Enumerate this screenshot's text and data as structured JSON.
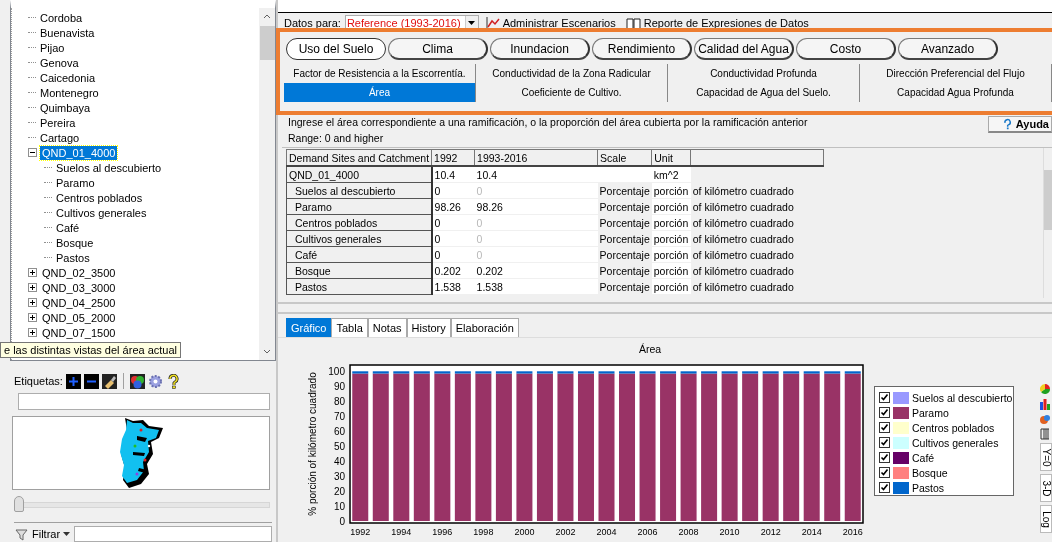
{
  "tree": [
    {
      "label": "Cordoba",
      "selected": false
    },
    {
      "label": "Buenavista",
      "selected": false
    },
    {
      "label": "Pijao",
      "selected": false
    },
    {
      "label": "Genova",
      "selected": false
    },
    {
      "label": "Caicedonia",
      "selected": false
    },
    {
      "label": "Montenegro",
      "selected": false
    },
    {
      "label": "Quimbaya",
      "selected": false
    },
    {
      "label": "Pereira",
      "selected": false
    },
    {
      "label": "Cartago",
      "selected": false
    },
    {
      "label": "QND_01_4000",
      "selected": true,
      "expanded": true,
      "children": [
        {
          "label": "Suelos al descubierto",
          "selected": false
        },
        {
          "label": "Paramo",
          "selected": false
        },
        {
          "label": "Centros poblados",
          "selected": false
        },
        {
          "label": "Cultivos generales",
          "selected": false
        },
        {
          "label": "Café",
          "selected": false
        },
        {
          "label": "Bosque",
          "selected": false
        },
        {
          "label": "Pastos",
          "selected": false
        }
      ]
    },
    {
      "label": "QND_02_3500",
      "selected": false,
      "expanded": false
    },
    {
      "label": "QND_03_3000",
      "selected": false,
      "expanded": false
    },
    {
      "label": "QND_04_2500",
      "selected": false,
      "expanded": false
    },
    {
      "label": "QND_05_2000",
      "selected": false,
      "expanded": false
    },
    {
      "label": "QND_07_1500",
      "selected": false,
      "expanded": false
    }
  ],
  "tooltip": "e las distintas vistas del área actual",
  "labels_toolbar": {
    "label": "Etiquetas:"
  },
  "zoom_slider": {
    "level": 0
  },
  "filter": {
    "label": "Filtrar"
  },
  "data_for": {
    "label": "Datos para:",
    "value": "Reference (1993-2016)"
  },
  "toolbar_buttons": [
    {
      "kind": "scenarios",
      "label": "Administrar Escenarios"
    },
    {
      "kind": "report",
      "label": "Reporte de Expresiones de Datos"
    }
  ],
  "categories": [
    {
      "label": "Uso del Suelo",
      "selected": true
    },
    {
      "label": "Clima",
      "selected": false
    },
    {
      "label": "Inundacion",
      "selected": false
    },
    {
      "label": "Rendimiento",
      "selected": false
    },
    {
      "label": "Calidad del Agua",
      "selected": false
    },
    {
      "label": "Costo",
      "selected": false
    },
    {
      "label": "Avanzado",
      "selected": false
    }
  ],
  "variable_tab_rows": [
    {
      "tabs": [
        {
          "label": "Factor de Resistencia a la Escorrentía.",
          "selected": false
        },
        {
          "label": "Conductividad de la Zona Radicular",
          "selected": false
        },
        {
          "label": "Conductividad Profunda",
          "selected": false
        },
        {
          "label": "Dirección Preferencial del Flujo",
          "selected": false
        }
      ]
    },
    {
      "tabs": [
        {
          "label": "Área",
          "selected": true
        },
        {
          "label": "Coeficiente de Cultivo.",
          "selected": false
        },
        {
          "label": "Capacidad de Agua del Suelo.",
          "selected": false
        },
        {
          "label": "Capacidad Agua Profunda",
          "selected": false
        }
      ]
    }
  ],
  "description": "Ingrese el área correspondiente a una ramificación, o la proporción del área cubierta por la ramificación anterior",
  "range": "Range: 0 and higher",
  "help_button": "Ayuda",
  "table": {
    "columns": [
      "Demand Sites and Catchment",
      "1992",
      "1993-2016",
      "Scale",
      "Unit"
    ],
    "rows": [
      {
        "kind": "parent",
        "name": "QND_01_4000",
        "y1992": "10.4",
        "y1993_2016": "10.4",
        "unit": "km^2",
        "dimmed": false
      },
      {
        "kind": "child",
        "name": "Suelos al descubierto",
        "y1992": "0",
        "y1993_2016": "0",
        "scale": "Porcentaje",
        "unit": "porción",
        "unit_suffix": "of kilómetro cuadrado",
        "dimmed": true
      },
      {
        "kind": "child",
        "name": "Paramo",
        "y1992": "98.26",
        "y1993_2016": "98.26",
        "scale": "Porcentaje",
        "unit": "porción",
        "unit_suffix": "of kilómetro cuadrado",
        "dimmed": false
      },
      {
        "kind": "child",
        "name": "Centros poblados",
        "y1992": "0",
        "y1993_2016": "0",
        "scale": "Porcentaje",
        "unit": "porción",
        "unit_suffix": "of kilómetro cuadrado",
        "dimmed": true
      },
      {
        "kind": "child",
        "name": "Cultivos generales",
        "y1992": "0",
        "y1993_2016": "0",
        "scale": "Porcentaje",
        "unit": "porción",
        "unit_suffix": "of kilómetro cuadrado",
        "dimmed": true
      },
      {
        "kind": "child",
        "name": "Café",
        "y1992": "0",
        "y1993_2016": "0",
        "scale": "Porcentaje",
        "unit": "porción",
        "unit_suffix": "of kilómetro cuadrado",
        "dimmed": true
      },
      {
        "kind": "child",
        "name": "Bosque",
        "y1992": "0.202",
        "y1993_2016": "0.202",
        "scale": "Porcentaje",
        "unit": "porción",
        "unit_suffix": "of kilómetro cuadrado",
        "dimmed": false
      },
      {
        "kind": "child",
        "name": "Pastos",
        "y1992": "1.538",
        "y1993_2016": "1.538",
        "scale": "Porcentaje",
        "unit": "porción",
        "unit_suffix": "of kilómetro cuadrado",
        "dimmed": false
      }
    ]
  },
  "view_tabs": [
    {
      "label": "Gráfico",
      "selected": true
    },
    {
      "label": "Tabla",
      "selected": false
    },
    {
      "label": "Notas",
      "selected": false
    },
    {
      "label": "History",
      "selected": false
    },
    {
      "label": "Elaboración",
      "selected": false
    }
  ],
  "chart_data": {
    "type": "bar",
    "stacked": true,
    "title": "Área",
    "ylabel": "% porción of kilómetro cuadrado",
    "x": [
      1992,
      1993,
      1994,
      1995,
      1996,
      1997,
      1998,
      1999,
      2000,
      2001,
      2002,
      2003,
      2004,
      2005,
      2006,
      2007,
      2008,
      2009,
      2010,
      2011,
      2012,
      2013,
      2014,
      2015,
      2016
    ],
    "xlim": [
      1991.5,
      2016.5
    ],
    "ylim": [
      0,
      100
    ],
    "yticks": [
      0,
      10,
      20,
      30,
      40,
      50,
      60,
      70,
      80,
      90,
      100
    ],
    "xticks": [
      1992,
      1994,
      1996,
      1998,
      2000,
      2002,
      2004,
      2006,
      2008,
      2010,
      2012,
      2014,
      2016
    ],
    "series": [
      {
        "name": "Suelos al descubierto",
        "color": "#9999ff",
        "values": [
          0,
          0,
          0,
          0,
          0,
          0,
          0,
          0,
          0,
          0,
          0,
          0,
          0,
          0,
          0,
          0,
          0,
          0,
          0,
          0,
          0,
          0,
          0,
          0,
          0
        ]
      },
      {
        "name": "Paramo",
        "color": "#993366",
        "values": [
          98.3,
          98.3,
          98.3,
          98.3,
          98.3,
          98.3,
          98.3,
          98.3,
          98.3,
          98.3,
          98.3,
          98.3,
          98.3,
          98.3,
          98.3,
          98.3,
          98.3,
          98.3,
          98.3,
          98.3,
          98.3,
          98.3,
          98.3,
          98.3,
          98.3
        ]
      },
      {
        "name": "Centros poblados",
        "color": "#ffffcc",
        "values": [
          0,
          0,
          0,
          0,
          0,
          0,
          0,
          0,
          0,
          0,
          0,
          0,
          0,
          0,
          0,
          0,
          0,
          0,
          0,
          0,
          0,
          0,
          0,
          0,
          0
        ]
      },
      {
        "name": "Cultivos generales",
        "color": "#ccffff",
        "values": [
          0,
          0,
          0,
          0,
          0,
          0,
          0,
          0,
          0,
          0,
          0,
          0,
          0,
          0,
          0,
          0,
          0,
          0,
          0,
          0,
          0,
          0,
          0,
          0,
          0
        ]
      },
      {
        "name": "Café",
        "color": "#660066",
        "values": [
          0,
          0,
          0,
          0,
          0,
          0,
          0,
          0,
          0,
          0,
          0,
          0,
          0,
          0,
          0,
          0,
          0,
          0,
          0,
          0,
          0,
          0,
          0,
          0,
          0
        ]
      },
      {
        "name": "Bosque",
        "color": "#ff8080",
        "values": [
          null,
          null,
          null,
          null,
          null,
          null,
          null,
          null,
          null,
          null,
          null,
          null,
          null,
          null,
          null,
          null,
          null,
          null,
          null,
          null,
          null,
          null,
          null,
          null,
          null
        ]
      },
      {
        "name": "Pastos",
        "color": "#0066cc",
        "values": [
          1.5,
          1.5,
          1.5,
          1.5,
          1.5,
          1.5,
          1.5,
          1.5,
          1.5,
          1.5,
          1.5,
          1.5,
          1.5,
          1.5,
          1.5,
          1.5,
          1.5,
          1.5,
          1.5,
          1.5,
          1.5,
          1.5,
          1.5,
          1.5,
          1.5
        ]
      }
    ]
  },
  "legend": [
    {
      "checked": true
    },
    {
      "checked": true
    },
    {
      "checked": true
    },
    {
      "checked": true
    },
    {
      "checked": true
    },
    {
      "checked": true
    },
    {
      "checked": true
    }
  ],
  "chart_side_tabs": [
    "Y=0",
    "3-D",
    "Log"
  ]
}
